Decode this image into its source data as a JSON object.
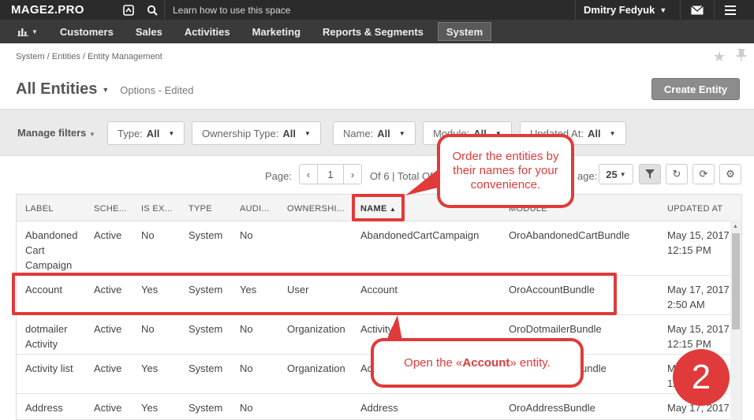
{
  "topbar": {
    "brand": "MAGE2.PRO",
    "search_placeholder": "Learn how to use this space",
    "user": "Dmitry Fedyuk"
  },
  "menu": [
    "Customers",
    "Sales",
    "Activities",
    "Marketing",
    "Reports & Segments",
    "System"
  ],
  "breadcrumb": "System / Entities / Entity Management",
  "title": "All Entities",
  "subtitle": "Options - Edited",
  "create_button": "Create Entity",
  "filters": {
    "manage": "Manage filters",
    "items": [
      {
        "label": "Type:",
        "value": "All"
      },
      {
        "label": "Ownership Type:",
        "value": "All"
      },
      {
        "label": "Name:",
        "value": "All"
      },
      {
        "label": "Module:",
        "value": "All"
      },
      {
        "label": "Updated At:",
        "value": "All"
      }
    ]
  },
  "pager": {
    "page_label": "Page:",
    "page": "1",
    "info": "Of 6 | Total Of",
    "per_page_label": "age:",
    "page_size": "25"
  },
  "columns": [
    "LABEL",
    "SCHE...",
    "IS EX...",
    "TYPE",
    "AUDI...",
    "OWNERSHI...",
    "NAME",
    "MODULE",
    "UPDATED AT"
  ],
  "rows": [
    {
      "label": "Abandoned Cart Campaign",
      "schema": "Active",
      "extend": "No",
      "type": "System",
      "audit": "No",
      "owner": "",
      "name": "AbandonedCartCampaign",
      "module": "OroAbandonedCartBundle",
      "updated_date": "May 15, 2017",
      "updated_time": "12:15 PM"
    },
    {
      "label": "Account",
      "schema": "Active",
      "extend": "Yes",
      "type": "System",
      "audit": "Yes",
      "owner": "User",
      "name": "Account",
      "module": "OroAccountBundle",
      "updated_date": "May 17, 2017",
      "updated_time": "2:50 AM"
    },
    {
      "label": "dotmailer Activity",
      "schema": "Active",
      "extend": "No",
      "type": "System",
      "audit": "No",
      "owner": "Organization",
      "name": "Activity",
      "module": "OroDotmailerBundle",
      "updated_date": "May 15, 2017",
      "updated_time": "12:15 PM"
    },
    {
      "label": "Activity list",
      "schema": "Active",
      "extend": "Yes",
      "type": "System",
      "audit": "No",
      "owner": "Organization",
      "name": "Ac",
      "module": "undle",
      "updated_date": "M",
      "updated_time": "12"
    },
    {
      "label": "Address",
      "schema": "Active",
      "extend": "Yes",
      "type": "System",
      "audit": "No",
      "owner": "",
      "name": "Address",
      "module": "OroAddressBundle",
      "updated_date": "May 17, 2017",
      "updated_time": ""
    }
  ],
  "annotations": {
    "callout_order": "Order the entities by their names for your convenience.",
    "callout_open_pre": "Open the «",
    "callout_open_bold": "Account",
    "callout_open_post": "» entity.",
    "step": "2"
  },
  "colors": {
    "accent": "#e03a3a",
    "topbar": "#2b2b2b",
    "menubar": "#3a3a3a"
  }
}
